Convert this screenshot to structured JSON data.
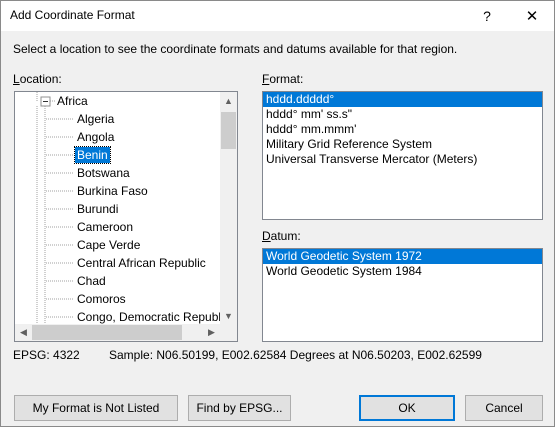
{
  "window": {
    "title": "Add Coordinate Format",
    "help_label": "?",
    "close_label": "✕"
  },
  "instruction": "Select a location to see the coordinate formats and datums available for that region.",
  "location": {
    "label_accel": "L",
    "label_rest": "ocation:",
    "tree": {
      "expander": "−",
      "root": "Africa",
      "items": [
        "Algeria",
        "Angola",
        "Benin",
        "Botswana",
        "Burkina Faso",
        "Burundi",
        "Cameroon",
        "Cape Verde",
        "Central African Republic",
        "Chad",
        "Comoros",
        "Congo, Democratic Republi"
      ],
      "selected_index": 2
    }
  },
  "format": {
    "label_accel": "F",
    "label_rest": "ormat:",
    "items": [
      "hddd.ddddd°",
      "hddd° mm' ss.s\"",
      "hddd° mm.mmm'",
      "Military Grid Reference System",
      "Universal Transverse Mercator (Meters)"
    ],
    "selected_index": 0
  },
  "datum": {
    "label_accel": "D",
    "label_rest": "atum:",
    "items": [
      "World Geodetic System 1972",
      "World Geodetic System 1984"
    ],
    "selected_index": 0
  },
  "status": {
    "epsg": "EPSG: 4322",
    "sample": "Sample: N06.50199, E002.62584 Degrees at N06.50203, E002.62599"
  },
  "buttons": {
    "not_listed": "My Format is Not Listed",
    "find_epsg": "Find by EPSG...",
    "ok": "OK",
    "cancel": "Cancel"
  },
  "colors": {
    "selection": "#0078d7",
    "dialog_bg": "#f0f0f0"
  }
}
